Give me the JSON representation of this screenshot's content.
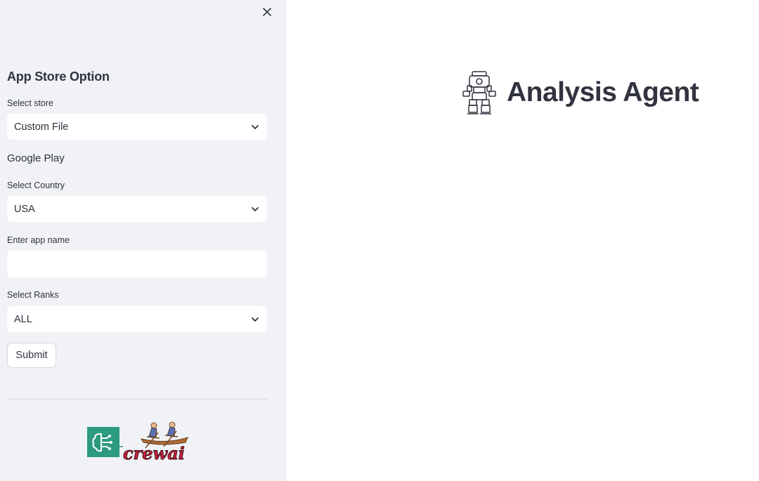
{
  "sidebar": {
    "close_icon": "close-icon",
    "heading": "App Store Option",
    "store_select": {
      "label": "Select store",
      "value": "Custom File"
    },
    "google_play_text": "Google Play",
    "country_select": {
      "label": "Select Country",
      "value": "USA"
    },
    "app_name_input": {
      "label": "Enter app name",
      "value": "",
      "placeholder": ""
    },
    "ranks_select": {
      "label": "Select Ranks",
      "value": "ALL"
    },
    "submit_label": "Submit",
    "logos": {
      "left_logo_icon": "brain-circuit-icon",
      "left_logo_color": "#2c9b7f",
      "right_logo_text": "crewai",
      "right_logo_color": "#c0223b"
    }
  },
  "main": {
    "title_icon": "robot-icon",
    "title": "Analysis Agent"
  },
  "colors": {
    "sidebar_bg": "#f0f2f6",
    "text": "#31333f",
    "input_bg": "#ffffff"
  }
}
